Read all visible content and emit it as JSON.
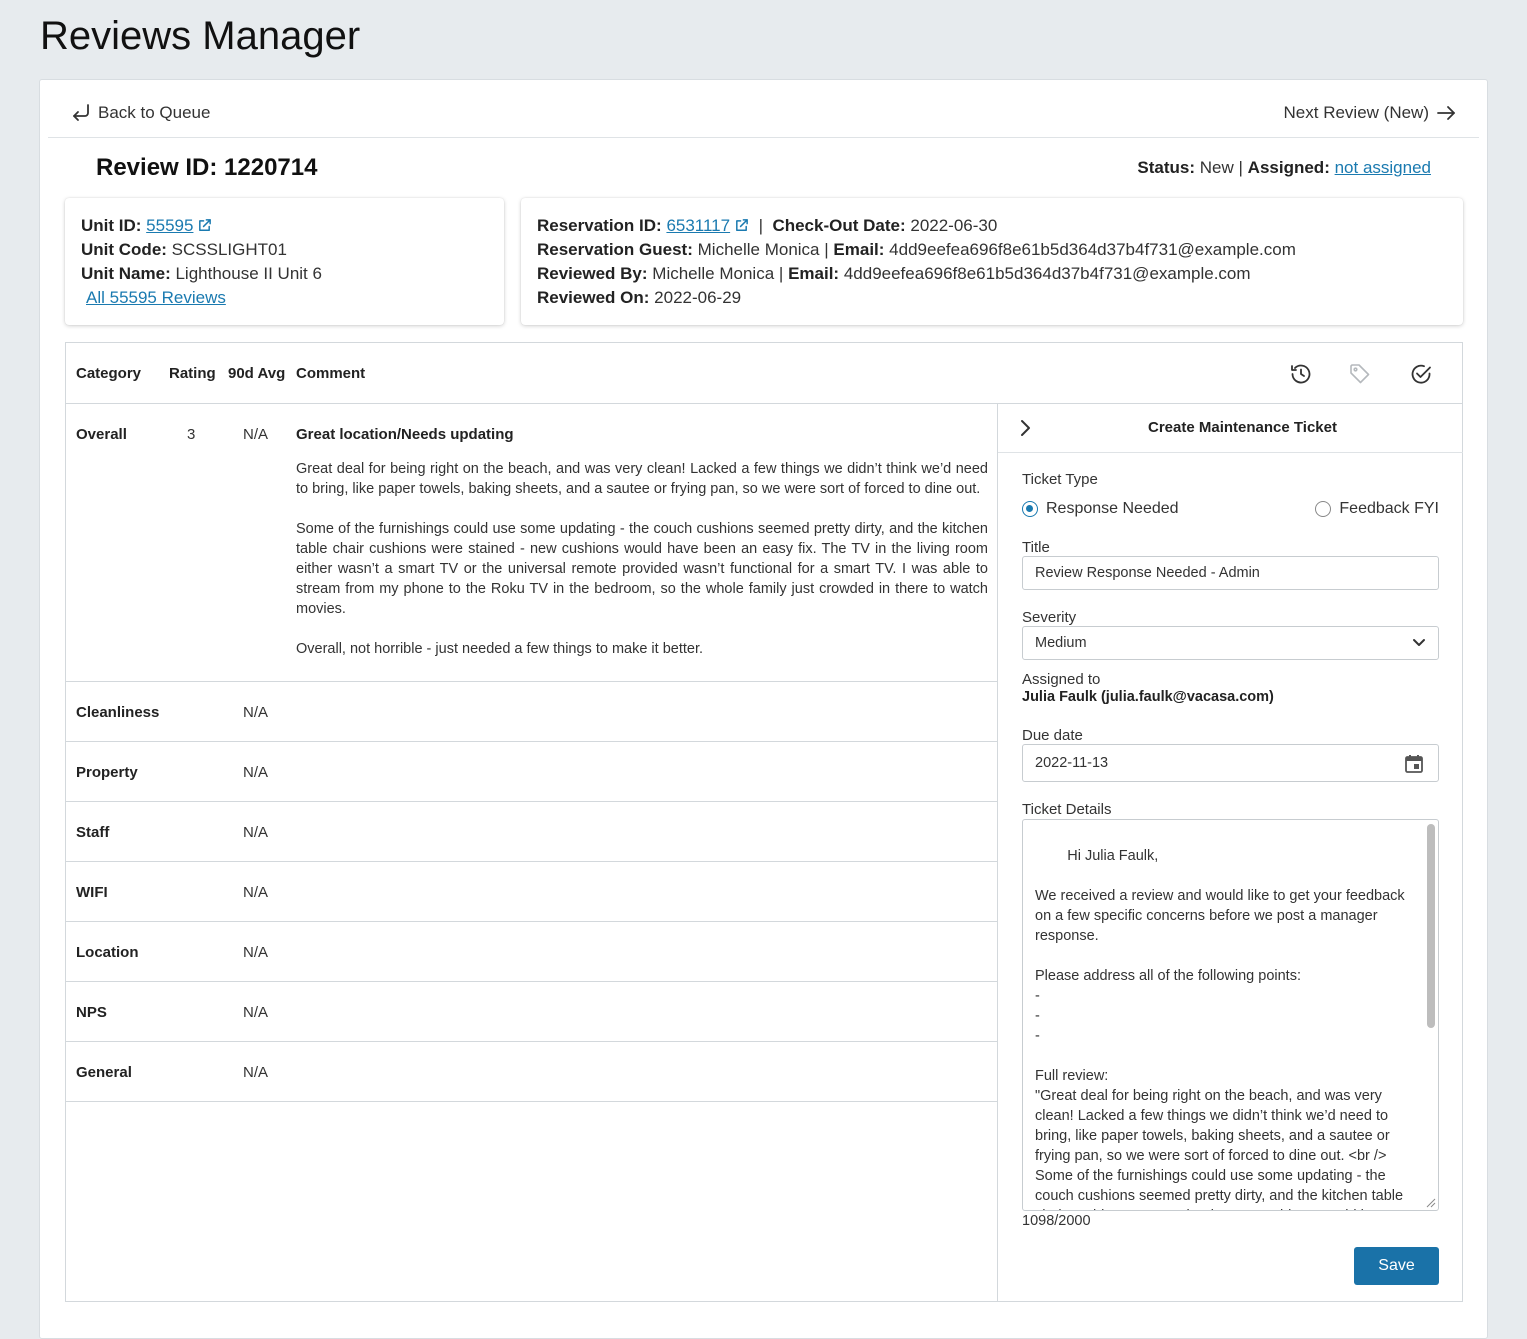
{
  "app": {
    "title": "Reviews Manager"
  },
  "nav": {
    "back_label": "Back to Queue",
    "next_label": "Next Review (New)"
  },
  "review": {
    "id_label": "Review ID: 1220714",
    "status_label": "Status:",
    "status_value": "New",
    "assigned_label": "Assigned:",
    "assigned_value": "not assigned",
    "separator": "|"
  },
  "unit": {
    "id_label": "Unit ID:",
    "id_value": "55595",
    "code_label": "Unit Code:",
    "code_value": "SCSSLIGHT01",
    "name_label": "Unit Name:",
    "name_value": "Lighthouse II Unit 6",
    "all_reviews_link": "All 55595 Reviews"
  },
  "reservation": {
    "id_label": "Reservation ID:",
    "id_value": "6531117",
    "checkout_label": "Check-Out Date:",
    "checkout_value": "2022-06-30",
    "guest_label": "Reservation Guest:",
    "guest_value": "Michelle Monica",
    "email_label": "Email:",
    "guest_email": "4dd9eefea696f8e61b5d364d37b4f731@example.com",
    "reviewed_by_label": "Reviewed By:",
    "reviewed_by_value": "Michelle Monica",
    "reviewer_email": "4dd9eefea696f8e61b5d364d37b4f731@example.com",
    "reviewed_on_label": "Reviewed On:",
    "reviewed_on_value": "2022-06-29",
    "separator": "|"
  },
  "table": {
    "headers": {
      "category": "Category",
      "rating": "Rating",
      "avg": "90d Avg",
      "comment": "Comment"
    },
    "header_icons": [
      "history-icon",
      "tag-icon",
      "check-circle-icon"
    ],
    "overall": {
      "category": "Overall",
      "rating": "3",
      "avg": "N/A",
      "comment_title": "Great location/Needs updating",
      "comment_paragraphs": [
        "Great deal for being right on the beach, and was very clean! Lacked a few things we didn’t think we’d need to bring, like paper towels, baking sheets, and a sautee or frying pan, so we were sort of forced to dine out.",
        "Some of the furnishings could use some updating - the couch cushions seemed pretty dirty, and the kitchen table chair cushions were stained - new cushions would have been an easy fix. The TV in the living room either wasn’t a smart TV or the universal remote provided wasn’t functional for a smart TV. I was able to stream from my phone to the Roku TV in the bedroom, so the whole family just crowded in there to watch movies.",
        "Overall, not horrible - just needed a few things to make it better."
      ]
    },
    "rows": [
      {
        "category": "Cleanliness",
        "avg": "N/A"
      },
      {
        "category": "Property",
        "avg": "N/A"
      },
      {
        "category": "Staff",
        "avg": "N/A"
      },
      {
        "category": "WIFI",
        "avg": "N/A"
      },
      {
        "category": "Location",
        "avg": "N/A"
      },
      {
        "category": "NPS",
        "avg": "N/A"
      },
      {
        "category": "General",
        "avg": "N/A"
      }
    ]
  },
  "ticket": {
    "panel_title": "Create Maintenance Ticket",
    "type_label": "Ticket Type",
    "type_options": [
      "Response Needed",
      "Feedback FYI"
    ],
    "type_selected": "Response Needed",
    "title_label": "Title",
    "title_value": "Review Response Needed - Admin",
    "severity_label": "Severity",
    "severity_value": "Medium",
    "assigned_label": "Assigned to",
    "assigned_value": "Julia Faulk (julia.faulk@vacasa.com)",
    "due_label": "Due date",
    "due_value": "2022-11-13",
    "details_label": "Ticket Details",
    "details_value": "Hi Julia Faulk,\n\nWe received a review and would like to get your feedback on a few specific concerns before we post a manager response.\n\nPlease address all of the following points:\n-\n-\n-\n\nFull review:\n\"Great deal for being right on the beach, and was very clean! Lacked a few things we didn’t think we’d need to bring, like paper towels, baking sheets, and a sautee or frying pan, so we were sort of forced to dine out. <br />\nSome of the furnishings could use some updating - the couch cushions seemed pretty dirty, and the kitchen table chair cushions were stained - new cushions would have been an easy fix. The TV in the living room either wasn’t a smart TV",
    "char_count": "1098/2000",
    "save_label": "Save"
  },
  "colors": {
    "link": "#1a7ab0",
    "primary_button": "#1a72a8",
    "page_bg": "#e7ebee"
  }
}
